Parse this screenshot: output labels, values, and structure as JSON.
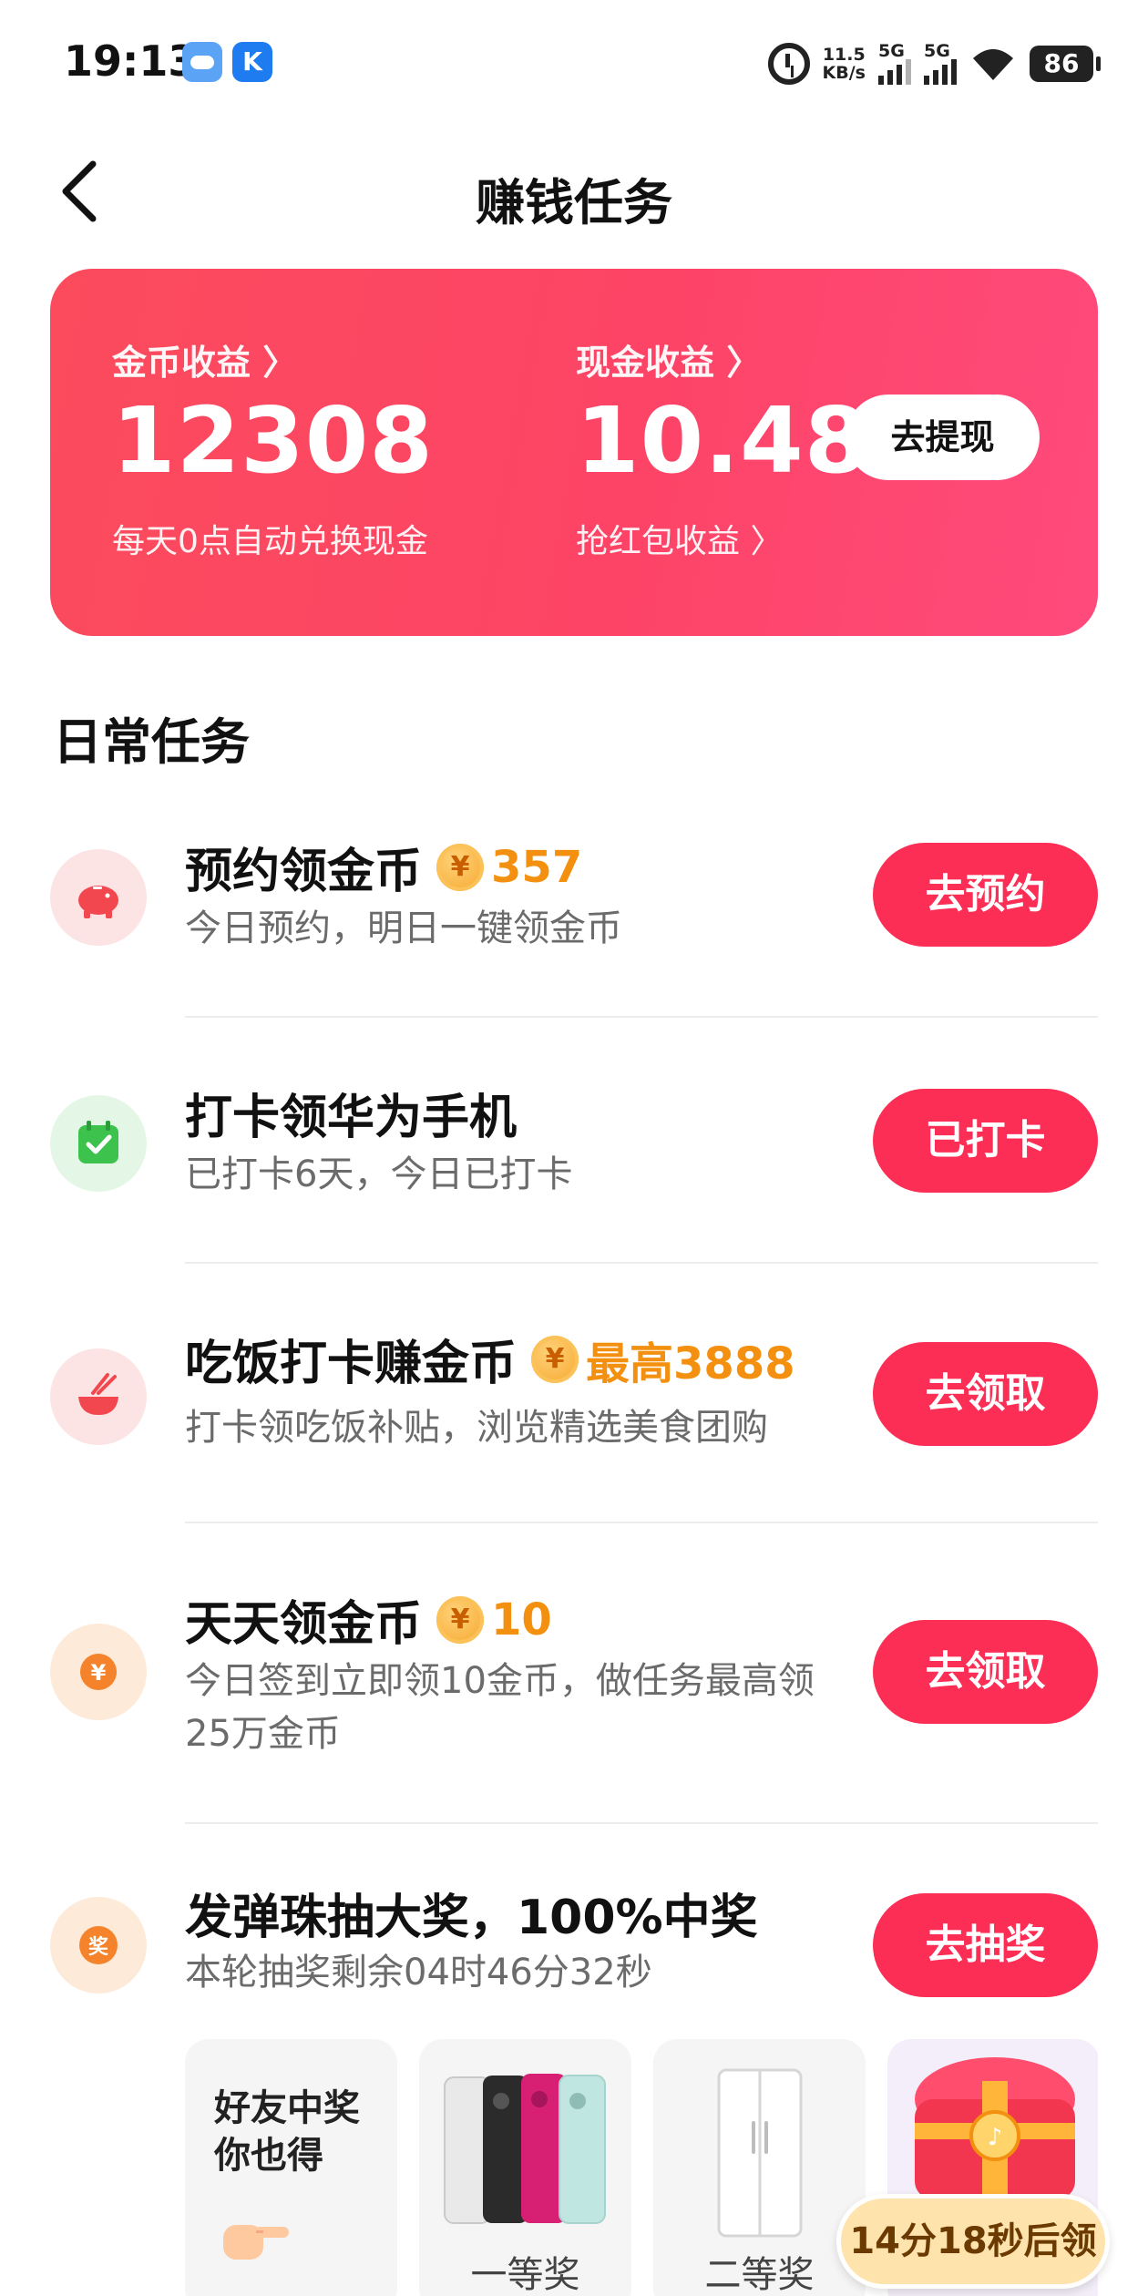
{
  "status_bar": {
    "time": "19:13",
    "k_icon_letter": "K",
    "net_speed_value": "11.5",
    "net_speed_unit": "KB/s",
    "signal_1_label": "5G",
    "signal_2_label": "5G",
    "battery": "86"
  },
  "header": {
    "title": "赚钱任务"
  },
  "earnings": {
    "coin_label": "金币收益 〉",
    "coin_value": "12308",
    "coin_sub": "每天0点自动兑换现金",
    "cash_label": "现金收益 〉",
    "cash_value": "10.48",
    "cash_sub": "抢红包收益 〉",
    "withdraw_label": "去提现"
  },
  "section_title": "日常任务",
  "tasks": [
    {
      "title": "预约领金币",
      "reward": "357",
      "desc": "今日预约，明日一键领金币",
      "button": "去预约",
      "icon": "piggy-bank-icon"
    },
    {
      "title": "打卡领华为手机",
      "reward": "",
      "desc": "已打卡6天，今日已打卡",
      "button": "已打卡",
      "icon": "calendar-check-icon"
    },
    {
      "title": "吃饭打卡赚金币",
      "reward": "最高3888",
      "desc": "打卡领吃饭补贴，浏览精选美食团购",
      "button": "去领取",
      "icon": "bowl-icon"
    },
    {
      "title": "天天领金币",
      "reward": "10",
      "desc": "今日签到立即领10金币，做任务最高领25万金币",
      "button": "去领取",
      "icon": "yen-coin-icon"
    },
    {
      "title": "发弹珠抽大奖，100%中奖",
      "reward": "",
      "desc": "本轮抽奖剩余04时46分32秒",
      "button": "去抽奖",
      "icon": "prize-icon"
    }
  ],
  "prize_icon_char": "奖",
  "coin_char": "¥",
  "prizes": {
    "friend_line1": "好友中奖",
    "friend_line2": "你也得",
    "first": "一等奖",
    "second": "二等奖"
  },
  "countdown": "14分18秒后领",
  "colors": {
    "card_gradient_start": "#fb4b5c",
    "card_gradient_end": "#ff4a7c",
    "button_red": "#fd2e55",
    "reward_orange": "#f39010"
  }
}
